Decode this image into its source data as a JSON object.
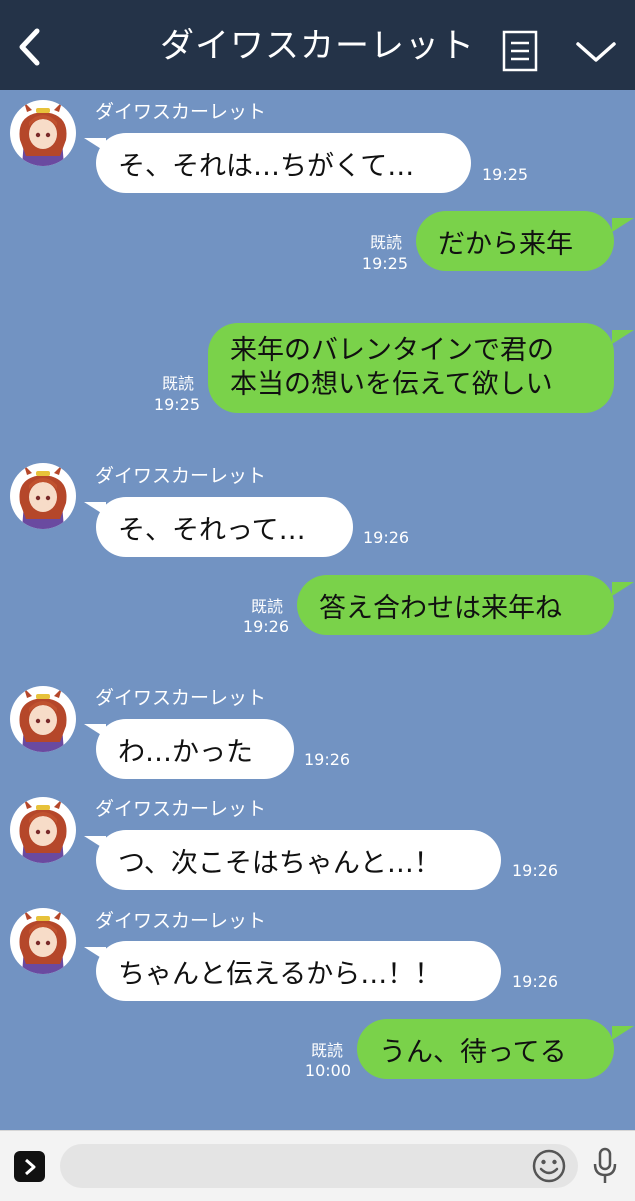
{
  "header": {
    "title": "ダイワスカーレット",
    "back_icon": "chevron-left-icon",
    "menu_icon": "menu-icon",
    "collapse_icon": "chevron-down-icon"
  },
  "messages": [
    {
      "sender": "ダイワスカーレット",
      "text": "そ、それは…ちがくて…",
      "time": "19:25"
    },
    {
      "read": "既読",
      "time": "19:25",
      "text": "だから来年"
    },
    {
      "read": "既読",
      "time": "19:25",
      "line1": "来年のバレンタインで君の",
      "line2": "本当の想いを伝えて欲しい"
    },
    {
      "sender": "ダイワスカーレット",
      "text": "そ、それって…",
      "time": "19:26"
    },
    {
      "read": "既読",
      "time": "19:26",
      "text": "答え合わせは来年ね"
    },
    {
      "sender": "ダイワスカーレット",
      "text": "わ…かった",
      "time": "19:26"
    },
    {
      "sender": "ダイワスカーレット",
      "text": "つ、次こそはちゃんと…！",
      "time": "19:26"
    },
    {
      "sender": "ダイワスカーレット",
      "text": "ちゃんと伝えるから…！！",
      "time": "19:26"
    },
    {
      "read": "既読",
      "time": "10:00",
      "text": "うん、待ってる"
    }
  ],
  "footer": {
    "expand_icon": "chevron-right-icon",
    "input_placeholder": "",
    "emoji_icon": "smiley-icon",
    "mic_icon": "microphone-icon"
  },
  "colors": {
    "header_bg": "#243348",
    "chat_bg": "#7293c2",
    "out_bubble": "#7ad24a",
    "in_bubble": "#ffffff"
  }
}
